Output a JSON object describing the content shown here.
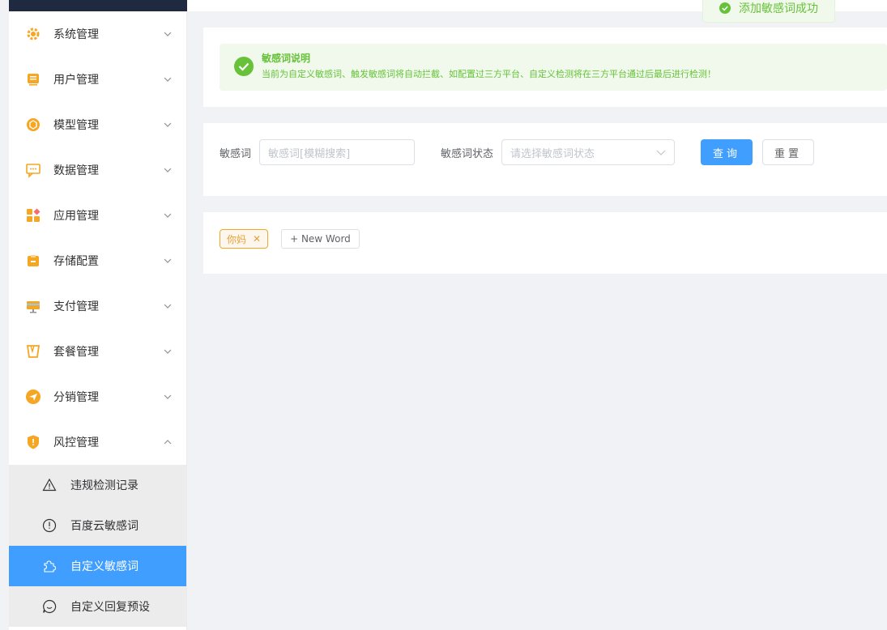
{
  "toast": {
    "text": "添加敏感词成功"
  },
  "sidebar": {
    "items": [
      {
        "label": "系统管理",
        "icon": "gear-icon"
      },
      {
        "label": "用户管理",
        "icon": "user-card-icon"
      },
      {
        "label": "模型管理",
        "icon": "cube-icon"
      },
      {
        "label": "数据管理",
        "icon": "chat-data-icon"
      },
      {
        "label": "应用管理",
        "icon": "apps-icon"
      },
      {
        "label": "存储配置",
        "icon": "storage-box-icon"
      },
      {
        "label": "支付管理",
        "icon": "payment-icon"
      },
      {
        "label": "套餐管理",
        "icon": "package-icon"
      },
      {
        "label": "分销管理",
        "icon": "send-icon"
      },
      {
        "label": "风控管理",
        "icon": "shield-icon"
      }
    ],
    "submenu": [
      {
        "label": "违规检测记录",
        "icon": "warning-icon"
      },
      {
        "label": "百度云敏感词",
        "icon": "info-circle-icon"
      },
      {
        "label": "自定义敏感词",
        "icon": "puzzle-icon",
        "active": true
      },
      {
        "label": "自定义回复预设",
        "icon": "chat-bubble-icon"
      }
    ]
  },
  "alert": {
    "title": "敏感词说明",
    "description": "当前为自定义敏感词、触发敏感词将自动拦截、如配置过三方平台、自定义检测将在三方平台通过后最后进行检测！"
  },
  "search": {
    "word_label": "敏感词",
    "word_placeholder": "敏感词[模糊搜索]",
    "status_label": "敏感词状态",
    "status_placeholder": "请选择敏感词状态",
    "query_button": "查询",
    "reset_button": "重置"
  },
  "words": {
    "tags": [
      "你妈"
    ],
    "new_word_button": "+ New Word"
  },
  "colors": {
    "primary": "#409eff",
    "success": "#67c23a",
    "warning": "#e6a23c",
    "sidebar_dark": "#1f2940"
  }
}
